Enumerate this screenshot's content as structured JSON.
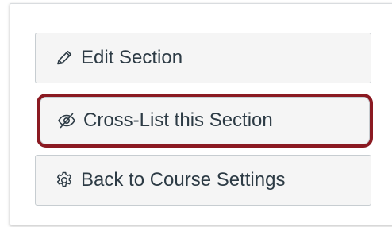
{
  "actions": {
    "edit_section": {
      "label": "Edit Section",
      "icon": "pencil-icon"
    },
    "cross_list": {
      "label": "Cross-List this Section",
      "icon": "eye-slash-icon"
    },
    "back_to_settings": {
      "label": "Back to Course Settings",
      "icon": "gear-icon"
    }
  },
  "colors": {
    "button_bg": "#f5f5f5",
    "button_border": "#c7cdd1",
    "text": "#2d3b45",
    "highlight_outline": "#8b1a22"
  }
}
